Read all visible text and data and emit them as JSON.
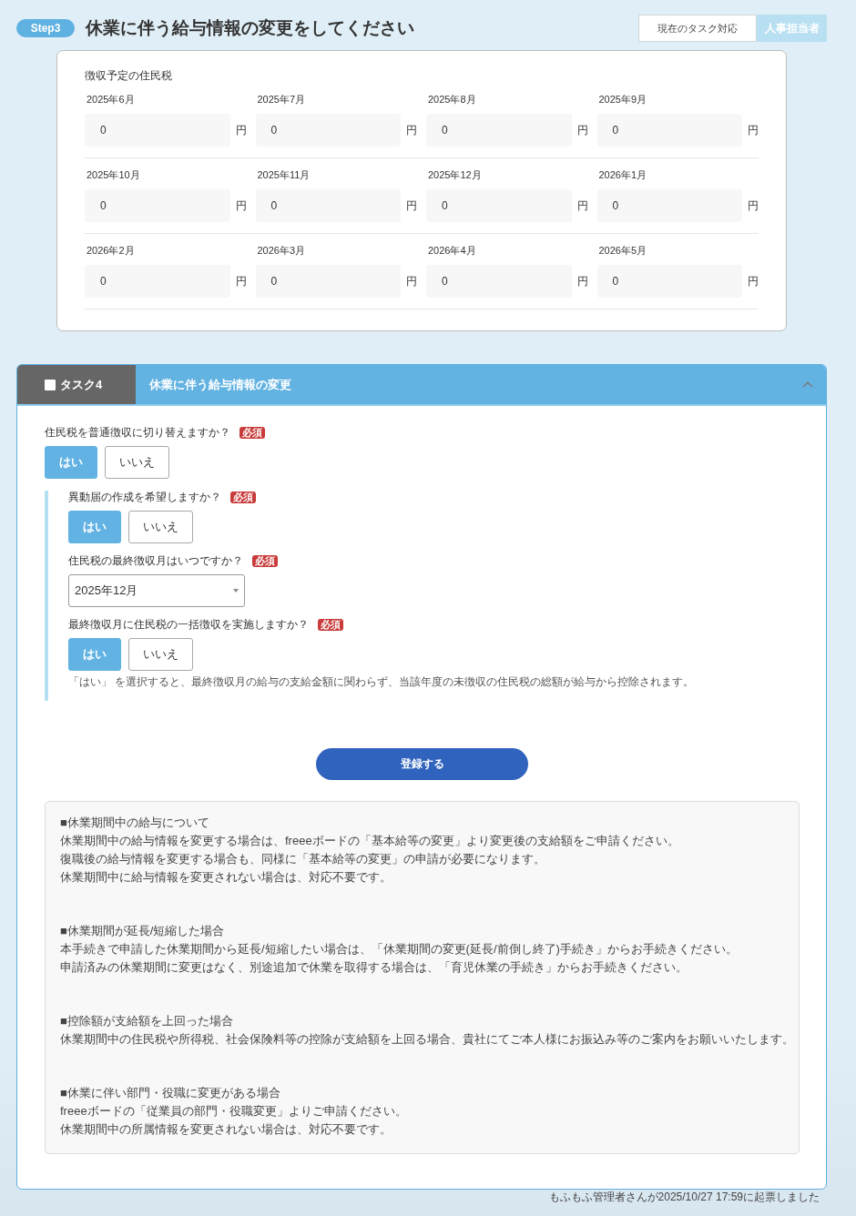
{
  "header": {
    "step": "Step3",
    "title": "休業に伴う給与情報の変更をしてください",
    "assignee_label": "現在のタスク対応",
    "assignee": "人事担当者"
  },
  "withholding": {
    "title": "徴収予定の住民税",
    "rows": [
      {
        "months": [
          {
            "label": "2025年6月",
            "value": "0",
            "unit": "円"
          },
          {
            "label": "2025年7月",
            "value": "0",
            "unit": "円"
          },
          {
            "label": "2025年8月",
            "value": "0",
            "unit": "円"
          },
          {
            "label": "2025年9月",
            "value": "0",
            "unit": "円"
          }
        ]
      },
      {
        "months": [
          {
            "label": "2025年10月",
            "value": "0",
            "unit": "円"
          },
          {
            "label": "2025年11月",
            "value": "0",
            "unit": "円"
          },
          {
            "label": "2025年12月",
            "value": "0",
            "unit": "円"
          },
          {
            "label": "2026年1月",
            "value": "0",
            "unit": "円"
          }
        ]
      },
      {
        "months": [
          {
            "label": "2026年2月",
            "value": "0",
            "unit": "円"
          },
          {
            "label": "2026年3月",
            "value": "0",
            "unit": "円"
          },
          {
            "label": "2026年4月",
            "value": "0",
            "unit": "円"
          },
          {
            "label": "2026年5月",
            "value": "0",
            "unit": "円"
          }
        ]
      }
    ]
  },
  "task": {
    "checked": false,
    "label": "タスク4",
    "title": "休業に伴う給与情報の変更",
    "expanded": true,
    "questions": [
      {
        "kind": "choice",
        "label": "住民税を普通徴収に切り替えますか？",
        "badge": "必須",
        "options": [
          {
            "label": "はい",
            "selected": true
          },
          {
            "label": "いいえ",
            "selected": false
          }
        ],
        "children": [
          {
            "kind": "choice",
            "label": "異動届の作成を希望しますか？",
            "badge": "必須",
            "options": [
              {
                "label": "はい",
                "selected": true
              },
              {
                "label": "いいえ",
                "selected": false
              }
            ]
          },
          {
            "kind": "select",
            "label": "住民税の最終徴収月はいつですか？",
            "badge": "必須",
            "value": "2025年12月"
          },
          {
            "kind": "choice",
            "label": "最終徴収月に住民税の一括徴収を実施しますか？",
            "badge": "必須",
            "options": [
              {
                "label": "はい",
                "selected": true
              },
              {
                "label": "いいえ",
                "selected": false
              }
            ],
            "note": "「はい」 を選択すると、最終徴収月の給与の支給金額に関わらず、当該年度の未徴収の住民税の総額が給与から控除されます。"
          }
        ]
      }
    ],
    "submit": "登録する",
    "info": [
      {
        "heading": "■休業期間中の給与について",
        "lines": [
          "休業期間中の給与情報を変更する場合は、freeeボードの「基本給等の変更」より変更後の支給額をご申請ください。",
          "復職後の給与情報を変更する場合も、同様に「基本給等の変更」の申請が必要になります。",
          "休業期間中に給与情報を変更されない場合は、対応不要です。"
        ]
      },
      {
        "heading": "■休業期間が延長/短縮した場合",
        "lines": [
          "本手続きで申請した休業期間から延長/短縮したい場合は、「休業期間の変更(延長/前倒し終了)手続き」からお手続きください。",
          "申請済みの休業期間に変更はなく、別途追加で休業を取得する場合は、「育児休業の手続き」からお手続きください。"
        ]
      },
      {
        "heading": "■控除額が支給額を上回った場合",
        "lines": [
          "休業期間中の住民税や所得税、社会保険料等の控除が支給額を上回る場合、貴社にてご本人様にお振込み等のご案内をお願いいたします。"
        ]
      },
      {
        "heading": "■休業に伴い部門・役職に変更がある場合",
        "lines": [
          "freeeボードの「従業員の部門・役職変更」よりご申請ください。",
          "休業期間中の所属情報を変更されない場合は、対応不要です。"
        ]
      }
    ]
  },
  "footer": "もふもふ管理者さんが2025/10/27 17:59に起票しました"
}
